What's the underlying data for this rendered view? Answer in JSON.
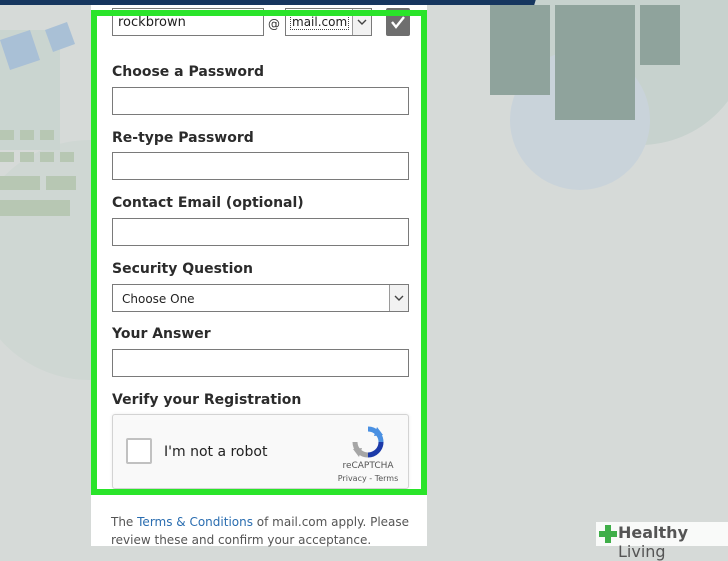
{
  "form": {
    "username_value": "rockbrown",
    "at_symbol": "@",
    "domain_selected": "mail.com",
    "password_label": "Choose a Password",
    "password_value": "",
    "retype_label": "Re-type Password",
    "retype_value": "",
    "contact_label": "Contact Email (optional)",
    "contact_value": "",
    "security_label": "Security Question",
    "security_selected": "Choose One",
    "answer_label": "Your Answer",
    "answer_value": "",
    "verify_label": "Verify your Registration"
  },
  "captcha": {
    "checkbox_label": "I'm not a robot",
    "brand": "reCAPTCHA",
    "links": "Privacy - Terms"
  },
  "terms": {
    "prefix": "The ",
    "link_text": "Terms & Conditions",
    "suffix": " of mail.com apply. Please review these and confirm your acceptance."
  },
  "watermark": {
    "brand_bold": "Healthy",
    "brand_light": " Living"
  },
  "colors": {
    "highlight": "#2ae42a",
    "topbar": "#16365f",
    "link": "#2a6db0",
    "recaptcha_blue": "#4a90e2"
  }
}
